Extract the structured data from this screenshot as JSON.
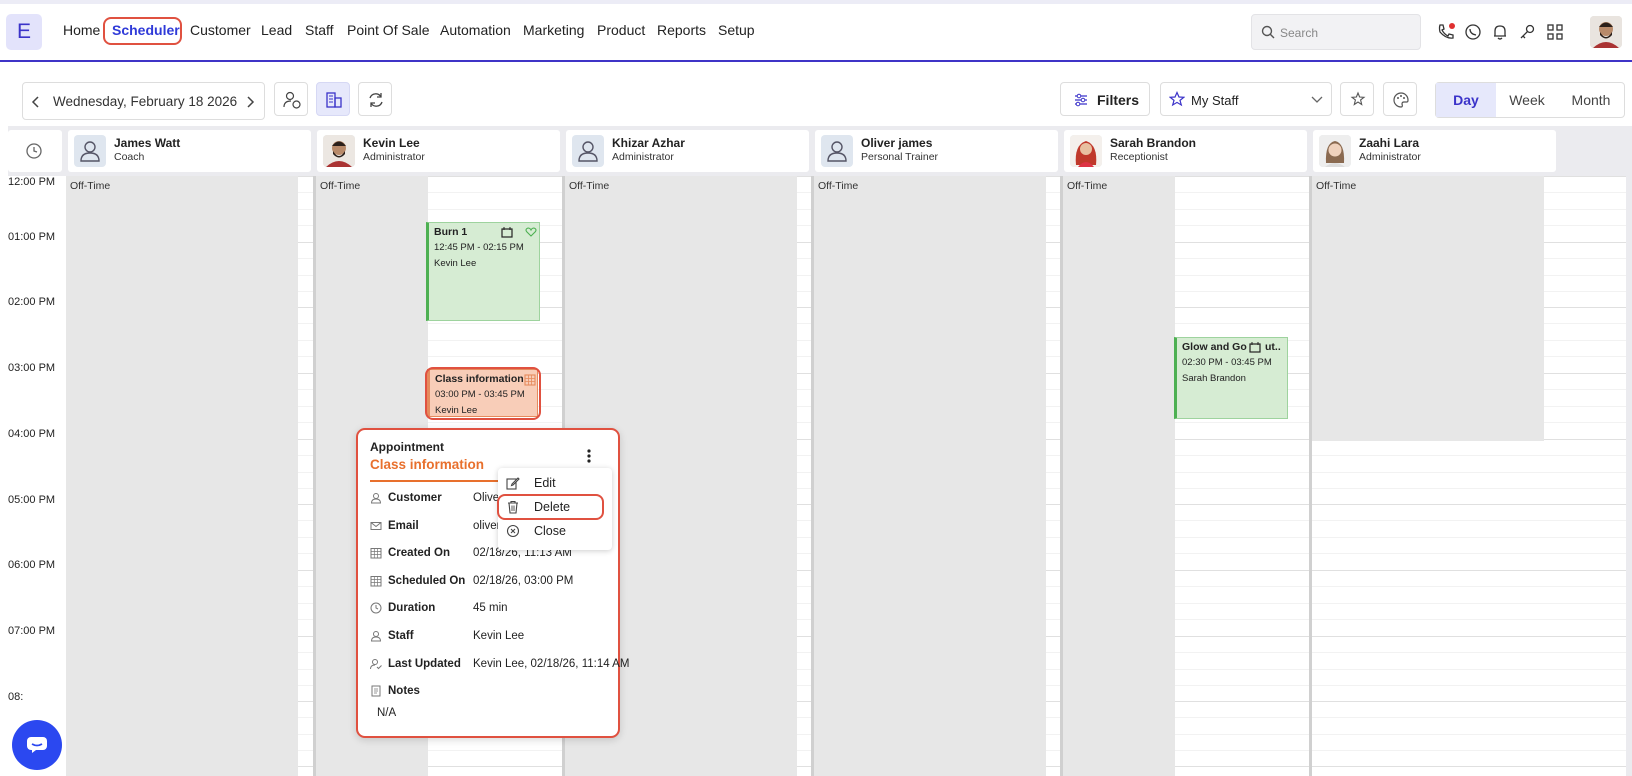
{
  "app": {
    "logo_letter": "E"
  },
  "nav": {
    "items": [
      "Home",
      "Scheduler",
      "Customer",
      "Lead",
      "Staff",
      "Point Of Sale",
      "Automation",
      "Marketing",
      "Product",
      "Reports",
      "Setup"
    ],
    "active": "Scheduler"
  },
  "search": {
    "placeholder": "Search"
  },
  "toolbar": {
    "date": "Wednesday, February 18 2026",
    "filters_label": "Filters",
    "staff_select": "My Staff",
    "views": [
      "Day",
      "Week",
      "Month"
    ],
    "active_view": "Day"
  },
  "staff": [
    {
      "name": "James Watt",
      "role": "Coach"
    },
    {
      "name": "Kevin Lee",
      "role": "Administrator"
    },
    {
      "name": "Khizar Azhar",
      "role": "Administrator"
    },
    {
      "name": "Oliver james",
      "role": "Personal Trainer"
    },
    {
      "name": "Sarah Brandon",
      "role": "Receptionist"
    },
    {
      "name": "Zaahi Lara",
      "role": "Administrator"
    }
  ],
  "times": [
    "12:00 PM",
    "01:00 PM",
    "02:00 PM",
    "03:00 PM",
    "04:00 PM",
    "05:00 PM",
    "06:00 PM",
    "07:00 PM",
    "08:"
  ],
  "off_time_label": "Off-Time",
  "appointments": {
    "burn": {
      "title": "Burn 1",
      "time": "12:45 PM - 02:15 PM",
      "staff": "Kevin Lee"
    },
    "class": {
      "title": "Class information",
      "time": "03:00 PM - 03:45 PM",
      "staff": "Kevin Lee"
    },
    "glow": {
      "title": "Glow and Go",
      "title_extra": "ut..",
      "time": "02:30 PM - 03:45 PM",
      "staff": "Sarah Brandon"
    }
  },
  "popup": {
    "type": "Appointment",
    "title": "Class information",
    "rows": [
      {
        "key": "Customer",
        "value": "Oliver"
      },
      {
        "key": "Email",
        "value": "oliver("
      },
      {
        "key": "Created On",
        "value": "02/18/26, 11:13 AM"
      },
      {
        "key": "Scheduled On",
        "value": "02/18/26, 03:00 PM"
      },
      {
        "key": "Duration",
        "value": "45 min"
      },
      {
        "key": "Staff",
        "value": "Kevin Lee"
      },
      {
        "key": "Last Updated",
        "value": "Kevin Lee, 02/18/26, 11:14 AM"
      },
      {
        "key": "Notes",
        "value": ""
      }
    ],
    "notes_value": "N/A"
  },
  "menu": {
    "edit": "Edit",
    "delete": "Delete",
    "close": "Close"
  },
  "colors": {
    "brand": "#3b33c9",
    "highlight": "#e05140",
    "appt_green": "#d6ecd3",
    "appt_orange": "#f8cdb8"
  }
}
